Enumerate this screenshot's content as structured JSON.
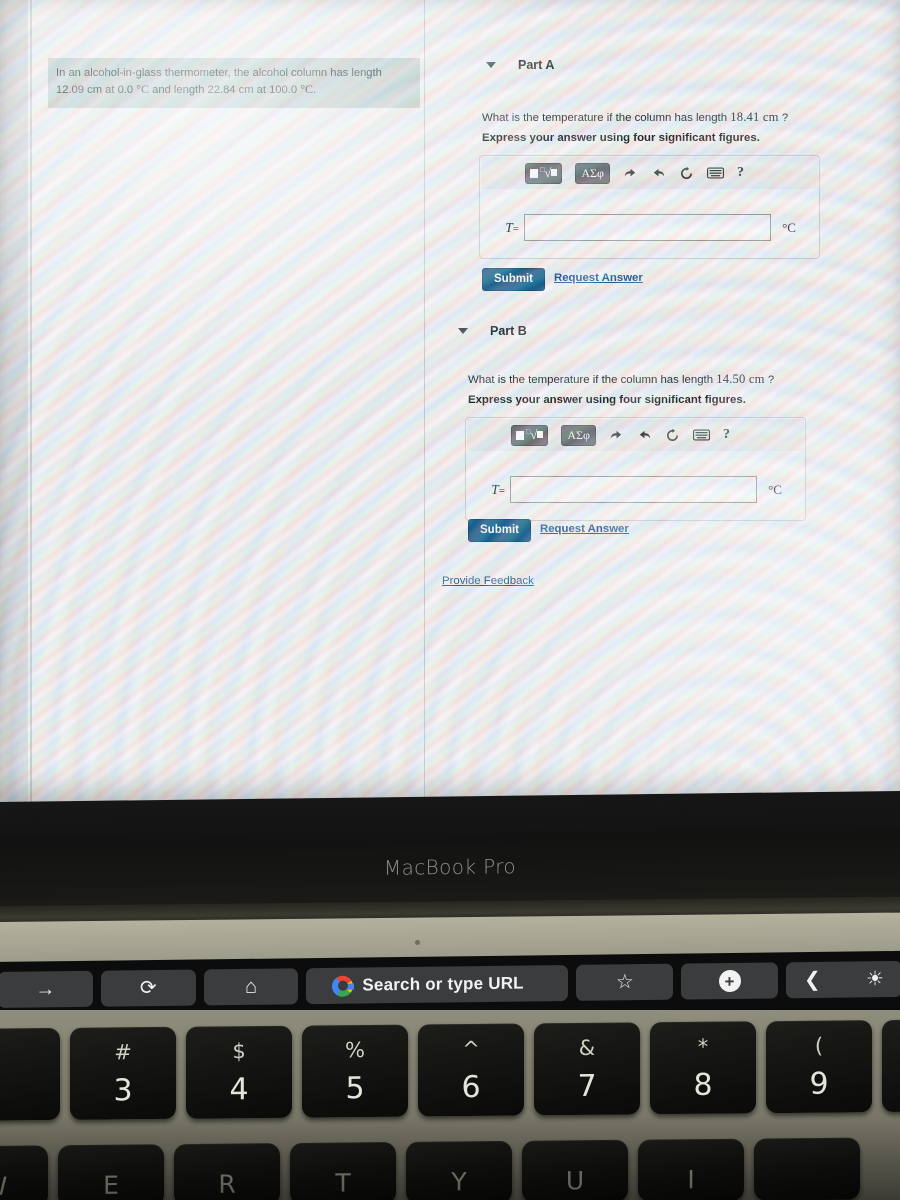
{
  "problem": {
    "text_line1": "In an alcohol-in-glass thermometer, the alcohol column has length",
    "text_line2_a": "12.09 cm at 0.0 ",
    "unit_c1": "°C",
    "text_line2_b": " and length 22.84 cm at 100.0 ",
    "unit_c2": "°C."
  },
  "parts": [
    {
      "title": "Part A",
      "question_prefix": "What is the temperature if the column has length ",
      "question_value": "18.41 cm",
      "question_suffix": " ?",
      "instruction": "Express your answer using four significant figures.",
      "toolbar": {
        "math_template_label": "math-template",
        "greek_label": "ΑΣφ",
        "undo_label": "undo",
        "redo_label": "redo",
        "reset_label": "reset",
        "keyboard_label": "keyboard",
        "help_label": "?"
      },
      "answer": {
        "label": "T",
        "equals": "=",
        "value": "",
        "placeholder": "",
        "unit": "°C"
      },
      "submit_label": "Submit",
      "request_answer_label": "Request Answer"
    },
    {
      "title": "Part B",
      "question_prefix": "What is the temperature if the column has length ",
      "question_value": "14.50 cm",
      "question_suffix": " ?",
      "instruction": "Express your answer using four significant figures.",
      "toolbar": {
        "math_template_label": "math-template",
        "greek_label": "ΑΣφ",
        "undo_label": "undo",
        "redo_label": "redo",
        "reset_label": "reset",
        "keyboard_label": "keyboard",
        "help_label": "?"
      },
      "answer": {
        "label": "T",
        "equals": "=",
        "value": "",
        "placeholder": "",
        "unit": "°C"
      },
      "submit_label": "Submit",
      "request_answer_label": "Request Answer"
    }
  ],
  "provide_feedback_label": "Provide Feedback",
  "laptop": {
    "brand": "MacBook Pro"
  },
  "touchbar": {
    "items": [
      {
        "icon": "arrow-right-icon",
        "glyph": "→",
        "label": ""
      },
      {
        "icon": "reload-icon",
        "glyph": "⟳",
        "label": ""
      },
      {
        "icon": "home-icon",
        "glyph": "⌂",
        "label": ""
      },
      {
        "icon": "google-icon",
        "glyph": "",
        "label": "Search or type URL"
      },
      {
        "icon": "star-icon",
        "glyph": "☆",
        "label": ""
      },
      {
        "icon": "new-tab-icon",
        "glyph": "+",
        "label": ""
      },
      {
        "icon": "back-chevron-icon",
        "glyph": "❮",
        "label": ""
      },
      {
        "icon": "brightness-icon",
        "glyph": "☀",
        "label": ""
      }
    ]
  },
  "keyboard": {
    "number_row": [
      {
        "top": "",
        "bottom": ""
      },
      {
        "top": "#",
        "bottom": "3"
      },
      {
        "top": "$",
        "bottom": "4"
      },
      {
        "top": "%",
        "bottom": "5"
      },
      {
        "top": "^",
        "bottom": "6"
      },
      {
        "top": "&",
        "bottom": "7"
      },
      {
        "top": "*",
        "bottom": "8"
      },
      {
        "top": "(",
        "bottom": "9"
      },
      {
        "top": "",
        "bottom": ""
      }
    ],
    "letter_row": [
      {
        "top": "",
        "bottom": "W"
      },
      {
        "top": "",
        "bottom": "E"
      },
      {
        "top": "",
        "bottom": "R"
      },
      {
        "top": "",
        "bottom": "T"
      },
      {
        "top": "",
        "bottom": "Y"
      },
      {
        "top": "",
        "bottom": "U"
      },
      {
        "top": "",
        "bottom": "I"
      },
      {
        "top": "",
        "bottom": ""
      }
    ]
  },
  "colors": {
    "submit_blue": "#16618f",
    "link_blue": "#1f5f96",
    "problem_box_bg": "#c4d4d2"
  }
}
